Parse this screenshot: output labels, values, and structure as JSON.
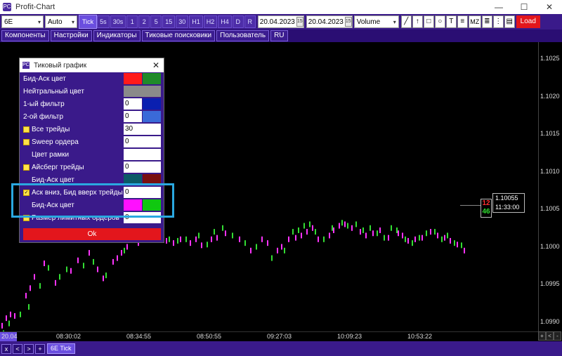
{
  "window": {
    "title": "Profit-Chart",
    "controls": [
      "—",
      "☐",
      "✕"
    ]
  },
  "toolbar": {
    "symbol": "6E",
    "mode": "Auto",
    "timeframes": [
      "Tick",
      "5s",
      "30s",
      "1",
      "2",
      "5",
      "15",
      "30",
      "H1",
      "H2",
      "H4",
      "D",
      "R"
    ],
    "active_timeframe": "Tick",
    "date_from": "20.04.2023",
    "date_to": "20.04.2023",
    "calendar_icon_label": "15",
    "volume_select": "Volume",
    "tools": [
      "╱",
      "↑",
      "□",
      "○",
      "T",
      "≡",
      "MZ",
      "≣",
      "⋮",
      "▤"
    ],
    "load_label": "Load"
  },
  "menu": [
    "Компоненты",
    "Настройки",
    "Индикаторы",
    "Тиковые поисковики",
    "Пользователь",
    "RU"
  ],
  "dialog": {
    "title": "Тиковый график",
    "close": "✕",
    "rows": [
      {
        "label": "Бид-Аск цвет",
        "type": "colors",
        "colors": [
          "#ff1a1a",
          "#1f8a2a"
        ]
      },
      {
        "label": "Нейтральный цвет",
        "type": "colors1",
        "colors": [
          "#8a8a8a"
        ]
      },
      {
        "label": "1-ый фильтр",
        "type": "valcolor",
        "value": "0",
        "color": "#0a1fb0"
      },
      {
        "label": "2-ой фильтр",
        "type": "valcolor",
        "value": "0",
        "color": "#3a6ad8"
      },
      {
        "label": "Все трейды",
        "type": "checkval",
        "value": "30",
        "checked": false
      },
      {
        "label": "Sweep ордера",
        "type": "checkval",
        "value": "0",
        "checked": false
      },
      {
        "label": "Цвет рамки",
        "type": "indval",
        "value": ""
      },
      {
        "label": "Айсберг трейды",
        "type": "checkval",
        "value": "0",
        "checked": false
      },
      {
        "label": "Бид-Аск цвет",
        "type": "indcolors",
        "colors": [
          "#0b5a66",
          "#7a1010"
        ]
      },
      {
        "label": "Аск вниз, Бид вверх трейды",
        "type": "checkval",
        "value": "0",
        "checked": true
      },
      {
        "label": "Бид-Аск цвет",
        "type": "indcolors",
        "colors": [
          "#ff10ff",
          "#10c810"
        ]
      },
      {
        "label": "Размер лимитных ордеров",
        "type": "checkval",
        "value": "0",
        "checked": false
      }
    ],
    "ok_label": "Ok"
  },
  "y_axis": [
    "1.1025",
    "1.1020",
    "1.1015",
    "1.1010",
    "1.1005",
    "1.1000",
    "1.0995",
    "1.0990"
  ],
  "x_axis": {
    "date": "20.04",
    "times": [
      "08:30:02",
      "08:34:55",
      "08:50:55",
      "09:27:03",
      "10:09:23",
      "10:53:22"
    ]
  },
  "price_label": {
    "price": "1.10055",
    "time": "11:33:00",
    "bid_count": "12",
    "ask_count": "46"
  },
  "bottom": {
    "nav": [
      "x",
      "<",
      ">",
      "+"
    ],
    "sheet": "6E Tick"
  },
  "colors": {
    "bid": "#ff33ff",
    "ask": "#33dd33"
  },
  "chart_data": {
    "type": "scatter",
    "series": [
      {
        "values": [
          [
            2,
            1.09895
          ],
          [
            8,
            1.09905
          ],
          [
            14,
            1.0991
          ],
          [
            20,
            1.09908
          ],
          [
            36,
            1.09935
          ],
          [
            42,
            1.09945
          ],
          [
            48,
            1.0996
          ],
          [
            62,
            1.09978
          ],
          [
            78,
            1.09952
          ],
          [
            100,
            1.09968
          ],
          [
            110,
            1.09982
          ],
          [
            126,
            1.09992
          ],
          [
            138,
            1.0997
          ],
          [
            146,
            1.09958
          ],
          [
            160,
            1.0998
          ],
          [
            166,
            1.09985
          ],
          [
            172,
            1.09992
          ],
          [
            180,
            1.1
          ],
          [
            196,
            1.10005
          ],
          [
            200,
            1.1001
          ],
          [
            212,
            1.10015
          ],
          [
            222,
            1.1002
          ],
          [
            236,
            1.10008
          ],
          [
            246,
            1.10005
          ],
          [
            256,
            1.1001
          ],
          [
            270,
            1.10005
          ],
          [
            278,
            1.1001
          ],
          [
            286,
            1.10002
          ],
          [
            300,
            1.1001
          ],
          [
            308,
            1.10012
          ],
          [
            320,
            1.10018
          ],
          [
            340,
            1.1001
          ],
          [
            356,
            1.09995
          ],
          [
            372,
            1.1001
          ],
          [
            380,
            1.10005
          ],
          [
            394,
            1.09995
          ],
          [
            400,
            1.1
          ],
          [
            410,
            1.1001
          ],
          [
            420,
            1.10012
          ],
          [
            428,
            1.10015
          ],
          [
            436,
            1.1002
          ],
          [
            444,
            1.10025
          ],
          [
            452,
            1.1001
          ],
          [
            468,
            1.10015
          ],
          [
            474,
            1.10022
          ],
          [
            482,
            1.10028
          ],
          [
            490,
            1.1003
          ],
          [
            500,
            1.10025
          ],
          [
            512,
            1.1002
          ],
          [
            520,
            1.10015
          ],
          [
            530,
            1.10018
          ],
          [
            540,
            1.10022
          ],
          [
            552,
            1.10012
          ],
          [
            566,
            1.10018
          ],
          [
            572,
            1.10015
          ],
          [
            580,
            1.10008
          ],
          [
            590,
            1.1001
          ],
          [
            600,
            1.10012
          ],
          [
            612,
            1.1002
          ],
          [
            622,
            1.10015
          ],
          [
            632,
            1.10012
          ],
          [
            640,
            1.10008
          ],
          [
            650,
            1.10003
          ],
          [
            660,
            1.09995
          ]
        ]
      },
      {
        "values": [
          [
            4,
            1.09885
          ],
          [
            12,
            1.09898
          ],
          [
            28,
            1.0991
          ],
          [
            40,
            1.0992
          ],
          [
            56,
            1.09948
          ],
          [
            68,
            1.09972
          ],
          [
            84,
            1.0996
          ],
          [
            94,
            1.0997
          ],
          [
            118,
            1.09975
          ],
          [
            132,
            1.0998
          ],
          [
            150,
            1.09962
          ],
          [
            176,
            1.09995
          ],
          [
            190,
            1.1001
          ],
          [
            206,
            1.10018
          ],
          [
            228,
            1.10015
          ],
          [
            240,
            1.1001
          ],
          [
            252,
            1.10008
          ],
          [
            264,
            1.1001
          ],
          [
            282,
            1.10015
          ],
          [
            294,
            1.10003
          ],
          [
            304,
            1.1002
          ],
          [
            316,
            1.10025
          ],
          [
            330,
            1.10015
          ],
          [
            348,
            1.10005
          ],
          [
            364,
            1.1
          ],
          [
            386,
            1.09985
          ],
          [
            404,
            1.09995
          ],
          [
            416,
            1.1002
          ],
          [
            424,
            1.10022
          ],
          [
            432,
            1.10028
          ],
          [
            440,
            1.1003
          ],
          [
            448,
            1.1002
          ],
          [
            460,
            1.1001
          ],
          [
            472,
            1.10025
          ],
          [
            486,
            1.10032
          ],
          [
            494,
            1.10028
          ],
          [
            506,
            1.1003
          ],
          [
            516,
            1.10022
          ],
          [
            526,
            1.10025
          ],
          [
            536,
            1.10018
          ],
          [
            546,
            1.10012
          ],
          [
            556,
            1.10025
          ],
          [
            564,
            1.10022
          ],
          [
            576,
            1.1001
          ],
          [
            586,
            1.10005
          ],
          [
            596,
            1.10012
          ],
          [
            606,
            1.10018
          ],
          [
            618,
            1.1002
          ],
          [
            628,
            1.1001
          ],
          [
            636,
            1.10015
          ],
          [
            646,
            1.10005
          ],
          [
            656,
            1.10002
          ]
        ]
      }
    ]
  }
}
